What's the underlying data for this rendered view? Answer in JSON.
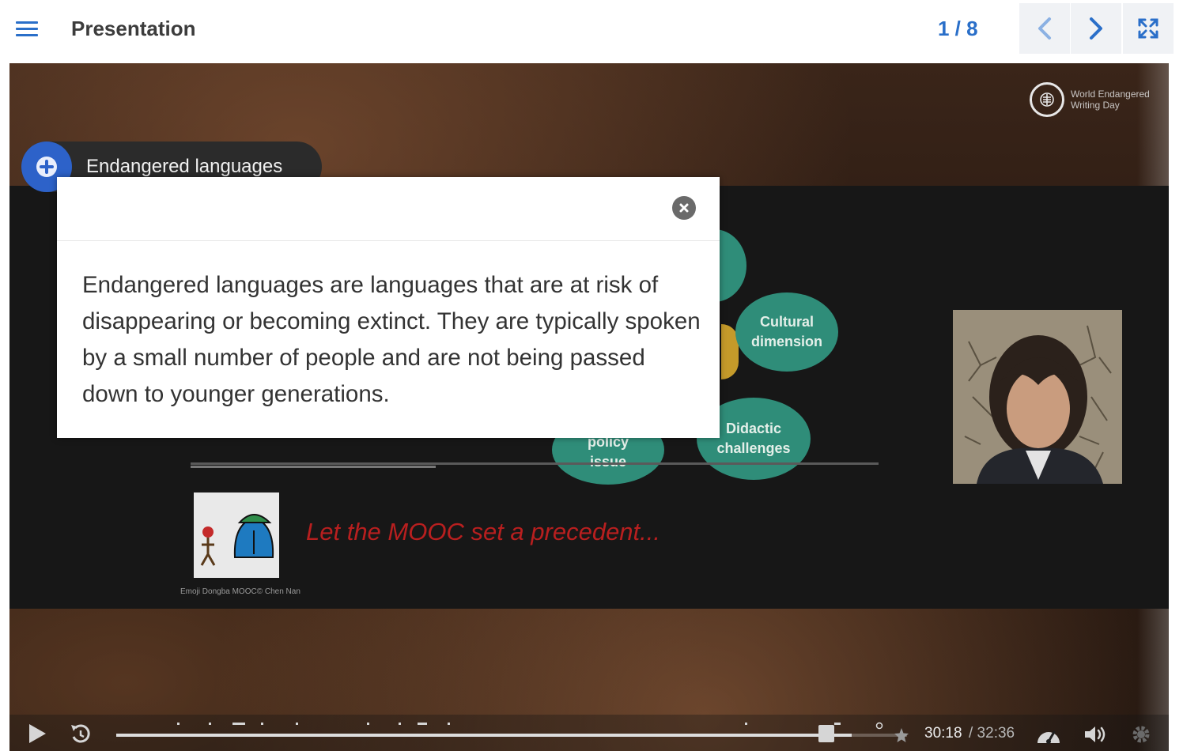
{
  "header": {
    "title": "Presentation",
    "page_counter": "1 / 8"
  },
  "slide": {
    "logo_text_line1": "World Endangered",
    "logo_text_line2": "Writing Day",
    "bubbles": [
      {
        "line1": "Cultural",
        "line2": "dimension"
      },
      {
        "line1": "Didactic",
        "line2": "challenges"
      },
      {
        "line1": "policy",
        "line2": "issue"
      }
    ],
    "tagline": "Let the MOOC set a precedent...",
    "credit": "Emoji Dongba MOOC© Chen Nan"
  },
  "hotspot": {
    "label": "Endangered languages"
  },
  "popup": {
    "text": "Endangered languages are languages that are at risk of disappearing or becoming extinct. They are typically spoken by a small number of people and are not being passed down to younger generations."
  },
  "player": {
    "current_time": "30:18",
    "duration": "/ 32:36",
    "progress": 0.93
  },
  "colors": {
    "accent_blue": "#2a6fc9",
    "bubble_green": "#2f8d79",
    "tagline_red": "#b81f1f"
  }
}
